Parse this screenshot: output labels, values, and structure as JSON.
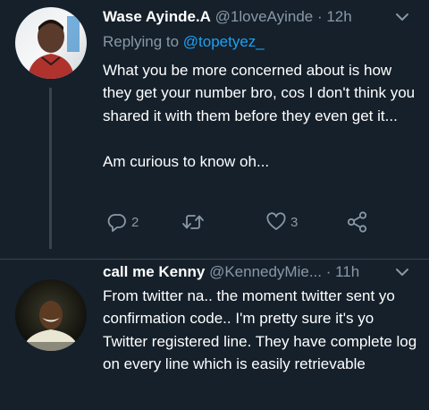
{
  "tweets": [
    {
      "name": "Wase Ayinde.A",
      "handle": "@1loveAyinde",
      "dot": " · ",
      "time": "12h",
      "replying_prefix": "Replying to ",
      "replying_to": "@topetyez_",
      "text": "What you be more concerned about is how they get your number bro, cos I don't think you shared it with them before they even get it...\n\nAm curious to know oh...",
      "replies": "2",
      "retweets": "",
      "likes": "3"
    },
    {
      "name": "call me Kenny",
      "handle": "@KennedyMie...",
      "dot": " · ",
      "time": "11h",
      "text": "From twitter na.. the moment twitter sent yo confirmation code.. I'm pretty sure it's yo Twitter registered line. They have complete log on every line which is easily retrievable"
    }
  ],
  "colors": {
    "background": "#15202b",
    "secondary_text": "#8899a6",
    "link": "#1da1f2",
    "divider": "#38444d"
  },
  "icons": {
    "reply": "reply-icon",
    "retweet": "retweet-icon",
    "like": "heart-icon",
    "share": "share-icon",
    "more": "chevron-down-icon"
  }
}
